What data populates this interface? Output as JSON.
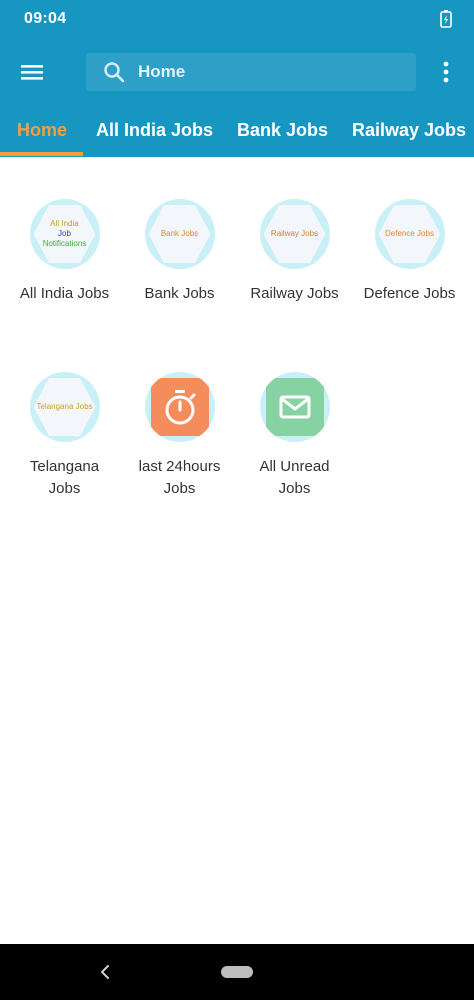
{
  "status_bar": {
    "time": "09:04"
  },
  "toolbar": {
    "search_placeholder": "Home"
  },
  "tabs": [
    {
      "label": "Home",
      "active": true
    },
    {
      "label": "All India Jobs"
    },
    {
      "label": "Bank Jobs"
    },
    {
      "label": "Railway Jobs"
    }
  ],
  "grid": [
    {
      "label": "All India Jobs",
      "thumb_lines": [
        "All India",
        "Job",
        "Notifications"
      ]
    },
    {
      "label": "Bank Jobs",
      "thumb_lines": [
        "Bank Jobs"
      ]
    },
    {
      "label": "Railway Jobs",
      "thumb_lines": [
        "Railway Jobs"
      ]
    },
    {
      "label": "Defence Jobs",
      "thumb_lines": [
        "Defence Jobs"
      ]
    },
    {
      "label_line1": "Telangana",
      "label_line2": "Jobs",
      "thumb_lines": [
        "Telangana Jobs"
      ]
    },
    {
      "label_line1": "last 24hours",
      "label_line2": "Jobs",
      "icon": "stopwatch-icon"
    },
    {
      "label_line1": "All Unread",
      "label_line2": "Jobs",
      "icon": "mail-icon"
    }
  ],
  "colors": {
    "primary": "#1796c2",
    "accent": "#f3a03c",
    "stopwatch_tile": "#f58c5b",
    "mail_tile": "#86d2a2"
  }
}
